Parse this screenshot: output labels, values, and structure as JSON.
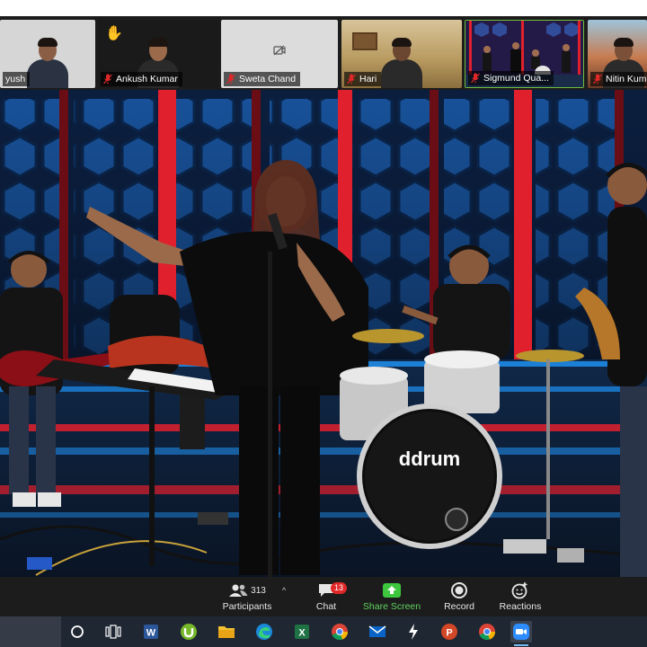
{
  "participants": [
    {
      "name": "yush",
      "muted": false,
      "bg": "#d9d9d9"
    },
    {
      "name": "Ankush Kumar",
      "muted": true,
      "raised_hand": true,
      "bg": "#1b1b1b"
    },
    {
      "name": "Sweta Chand",
      "muted": true,
      "camera_off": true,
      "bg": "#dcdcdc"
    },
    {
      "name": "Hari",
      "muted": true,
      "bg": "#c9b28a"
    },
    {
      "name": "Sigmund Qua...",
      "muted": true,
      "bg": "#2d2350"
    },
    {
      "name": "Nitin Kuma",
      "muted": true,
      "bg": "#b85a3a"
    }
  ],
  "stage": {
    "drum_brand": "ddrum"
  },
  "toolbar": {
    "participants_label": "Participants",
    "participants_count": "313",
    "chat_label": "Chat",
    "chat_badge": "13",
    "share_label": "Share Screen",
    "record_label": "Record",
    "reactions_label": "Reactions"
  },
  "taskbar": {
    "apps": [
      "search",
      "task-view",
      "word",
      "utorrent",
      "file-explorer",
      "edge",
      "excel",
      "chrome",
      "mail",
      "app",
      "powerpoint",
      "chrome-2",
      "zoom"
    ],
    "active": "zoom"
  },
  "colors": {
    "toolbar_bg": "#1c1c1c",
    "share_green": "#5fd35f",
    "badge_red": "#e02828",
    "mute_red": "#e02828",
    "stage_blue": "#1a5fb4",
    "stage_red": "#e0202c",
    "taskbar_bg": "#1f2733"
  }
}
